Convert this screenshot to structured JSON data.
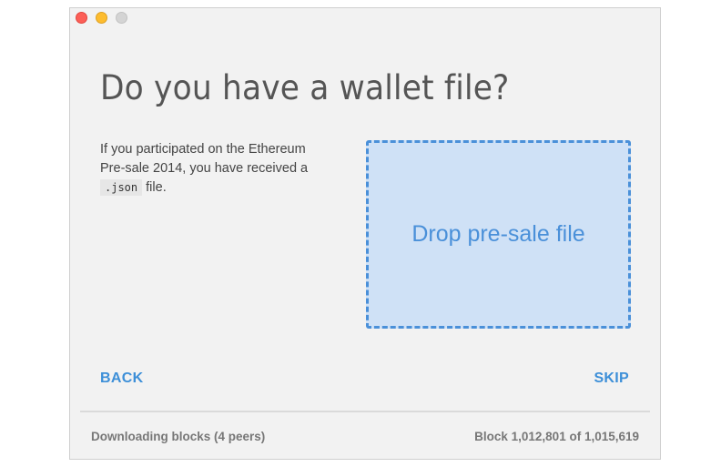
{
  "window": {
    "controls": [
      "close",
      "minimize",
      "zoom"
    ]
  },
  "main": {
    "title": "Do you have a wallet file?",
    "description": {
      "line1": "If you participated on the Ethereum",
      "line2": "Pre-sale 2014, you have received a",
      "code": ".json",
      "suffix": "file."
    },
    "dropzone": {
      "label": "Drop pre-sale file"
    }
  },
  "nav": {
    "back_label": "BACK",
    "skip_label": "SKIP"
  },
  "status": {
    "left": "Downloading blocks (4 peers)",
    "right": "Block 1,012,801 of 1,015,619"
  },
  "colors": {
    "accent": "#4a90d9",
    "dropzone_bg": "#cfe1f6",
    "window_bg": "#f2f2f2"
  }
}
